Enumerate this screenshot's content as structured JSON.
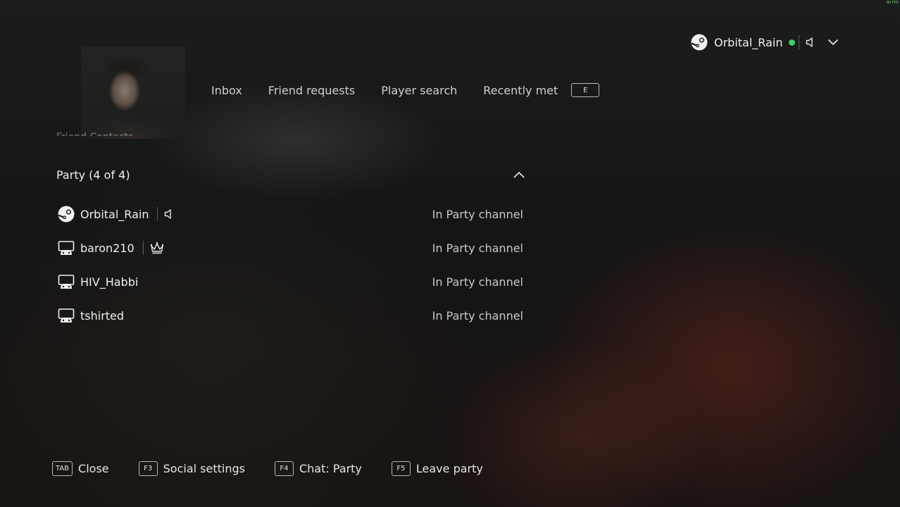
{
  "overlay": {
    "fps": "60 FPS"
  },
  "account": {
    "username": "Orbital_Rain",
    "status_color": "#3ccf6a",
    "icons": [
      "steam-icon",
      "online-dot",
      "speaker-icon",
      "chevron-down-icon"
    ]
  },
  "tabs": [
    {
      "label": "Inbox"
    },
    {
      "label": "Friend requests"
    },
    {
      "label": "Player search"
    },
    {
      "label": "Recently met"
    }
  ],
  "tabs_hotkey": "E",
  "partial_text": "Friend Contacts",
  "party": {
    "title": "Party (4 of 4)",
    "members": [
      {
        "name": "Orbital_Rain",
        "platform": "steam-icon",
        "badge": "speaker-icon",
        "status": "In Party channel"
      },
      {
        "name": "baron210",
        "platform": "controller-icon",
        "badge": "crown-icon",
        "status": "In Party channel"
      },
      {
        "name": "HIV_Habbi",
        "platform": "controller-icon",
        "badge": "",
        "status": "In Party channel"
      },
      {
        "name": "tshirted",
        "platform": "controller-icon",
        "badge": "",
        "status": "In Party channel"
      }
    ]
  },
  "hints": [
    {
      "key": "TAB",
      "label": "Close"
    },
    {
      "key": "F3",
      "label": "Social settings"
    },
    {
      "key": "F4",
      "label": "Chat: Party"
    },
    {
      "key": "F5",
      "label": "Leave party"
    }
  ]
}
